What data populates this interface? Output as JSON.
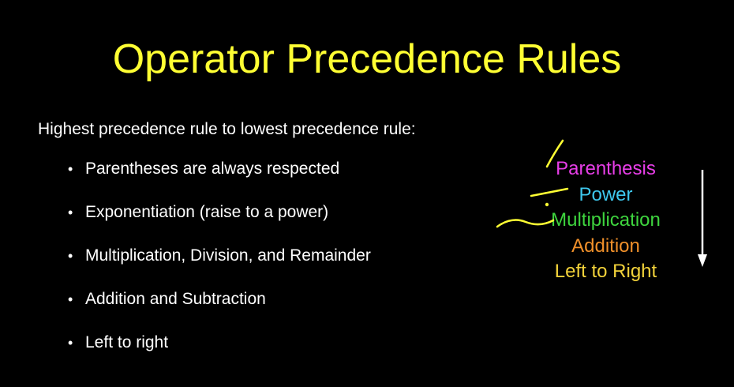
{
  "slide": {
    "title": "Operator Precedence Rules",
    "intro": "Highest precedence rule to lowest precedence rule:",
    "rules": [
      "Parentheses are always respected",
      "Exponentiation (raise to a power)",
      "Multiplication, Division, and Remainder",
      "Addition and Subtraction",
      "Left to right"
    ],
    "bullet_glyph": "•"
  },
  "mnemonic": {
    "items": [
      {
        "label": "Parenthesis",
        "color": "#e83ee8"
      },
      {
        "label": "Power",
        "color": "#3ec8ee"
      },
      {
        "label": "Multiplication",
        "color": "#3ed43e"
      },
      {
        "label": "Addition",
        "color": "#f0902a"
      },
      {
        "label": "Left to Right",
        "color": "#f2d23a"
      }
    ],
    "arrow_direction": "down",
    "arrow_color": "#ffffff",
    "annotation_color": "#ffff33"
  },
  "colors": {
    "background": "#000000",
    "title": "#ffff33",
    "body_text": "#ffffff"
  }
}
